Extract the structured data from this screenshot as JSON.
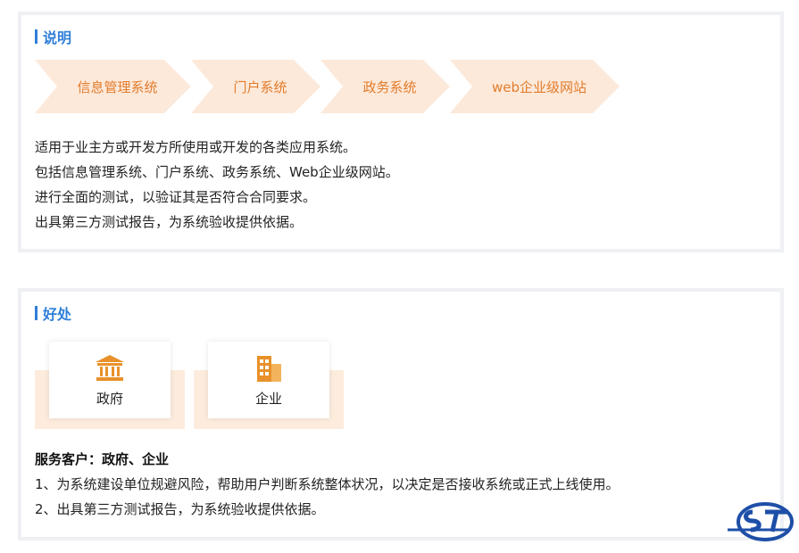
{
  "intro": {
    "title": "说明",
    "steps": [
      "信息管理系统",
      "门户系统",
      "政务系统",
      "web企业级网站"
    ],
    "lines": [
      "适用于业主方或开发方所使用或开发的各类应用系统。",
      "包括信息管理系统、门户系统、政务系统、Web企业级网站。",
      "进行全面的测试，以验证其是否符合合同要求。",
      "出具第三方测试报告，为系统验收提供依据。"
    ]
  },
  "benefits": {
    "title": "好处",
    "cards": [
      {
        "label": "政府",
        "icon": "government-building-icon"
      },
      {
        "label": "企业",
        "icon": "enterprise-building-icon"
      }
    ],
    "heading": "服务客户：政府、企业",
    "lines": [
      "1、为系统建设单位规避风险，帮助用户判断系统整体状况，以决定是否接收系统或正式上线使用。",
      "2、出具第三方测试报告，为系统验收提供依据。"
    ]
  },
  "logo": {
    "icon": "company-logo-icon"
  },
  "colors": {
    "accent_blue": "#2f7fd9",
    "accent_orange": "#e27c2b",
    "chevron_bg": "#fde9da",
    "icon_orange": "#e8912a",
    "logo_blue": "#1e4fa8"
  }
}
